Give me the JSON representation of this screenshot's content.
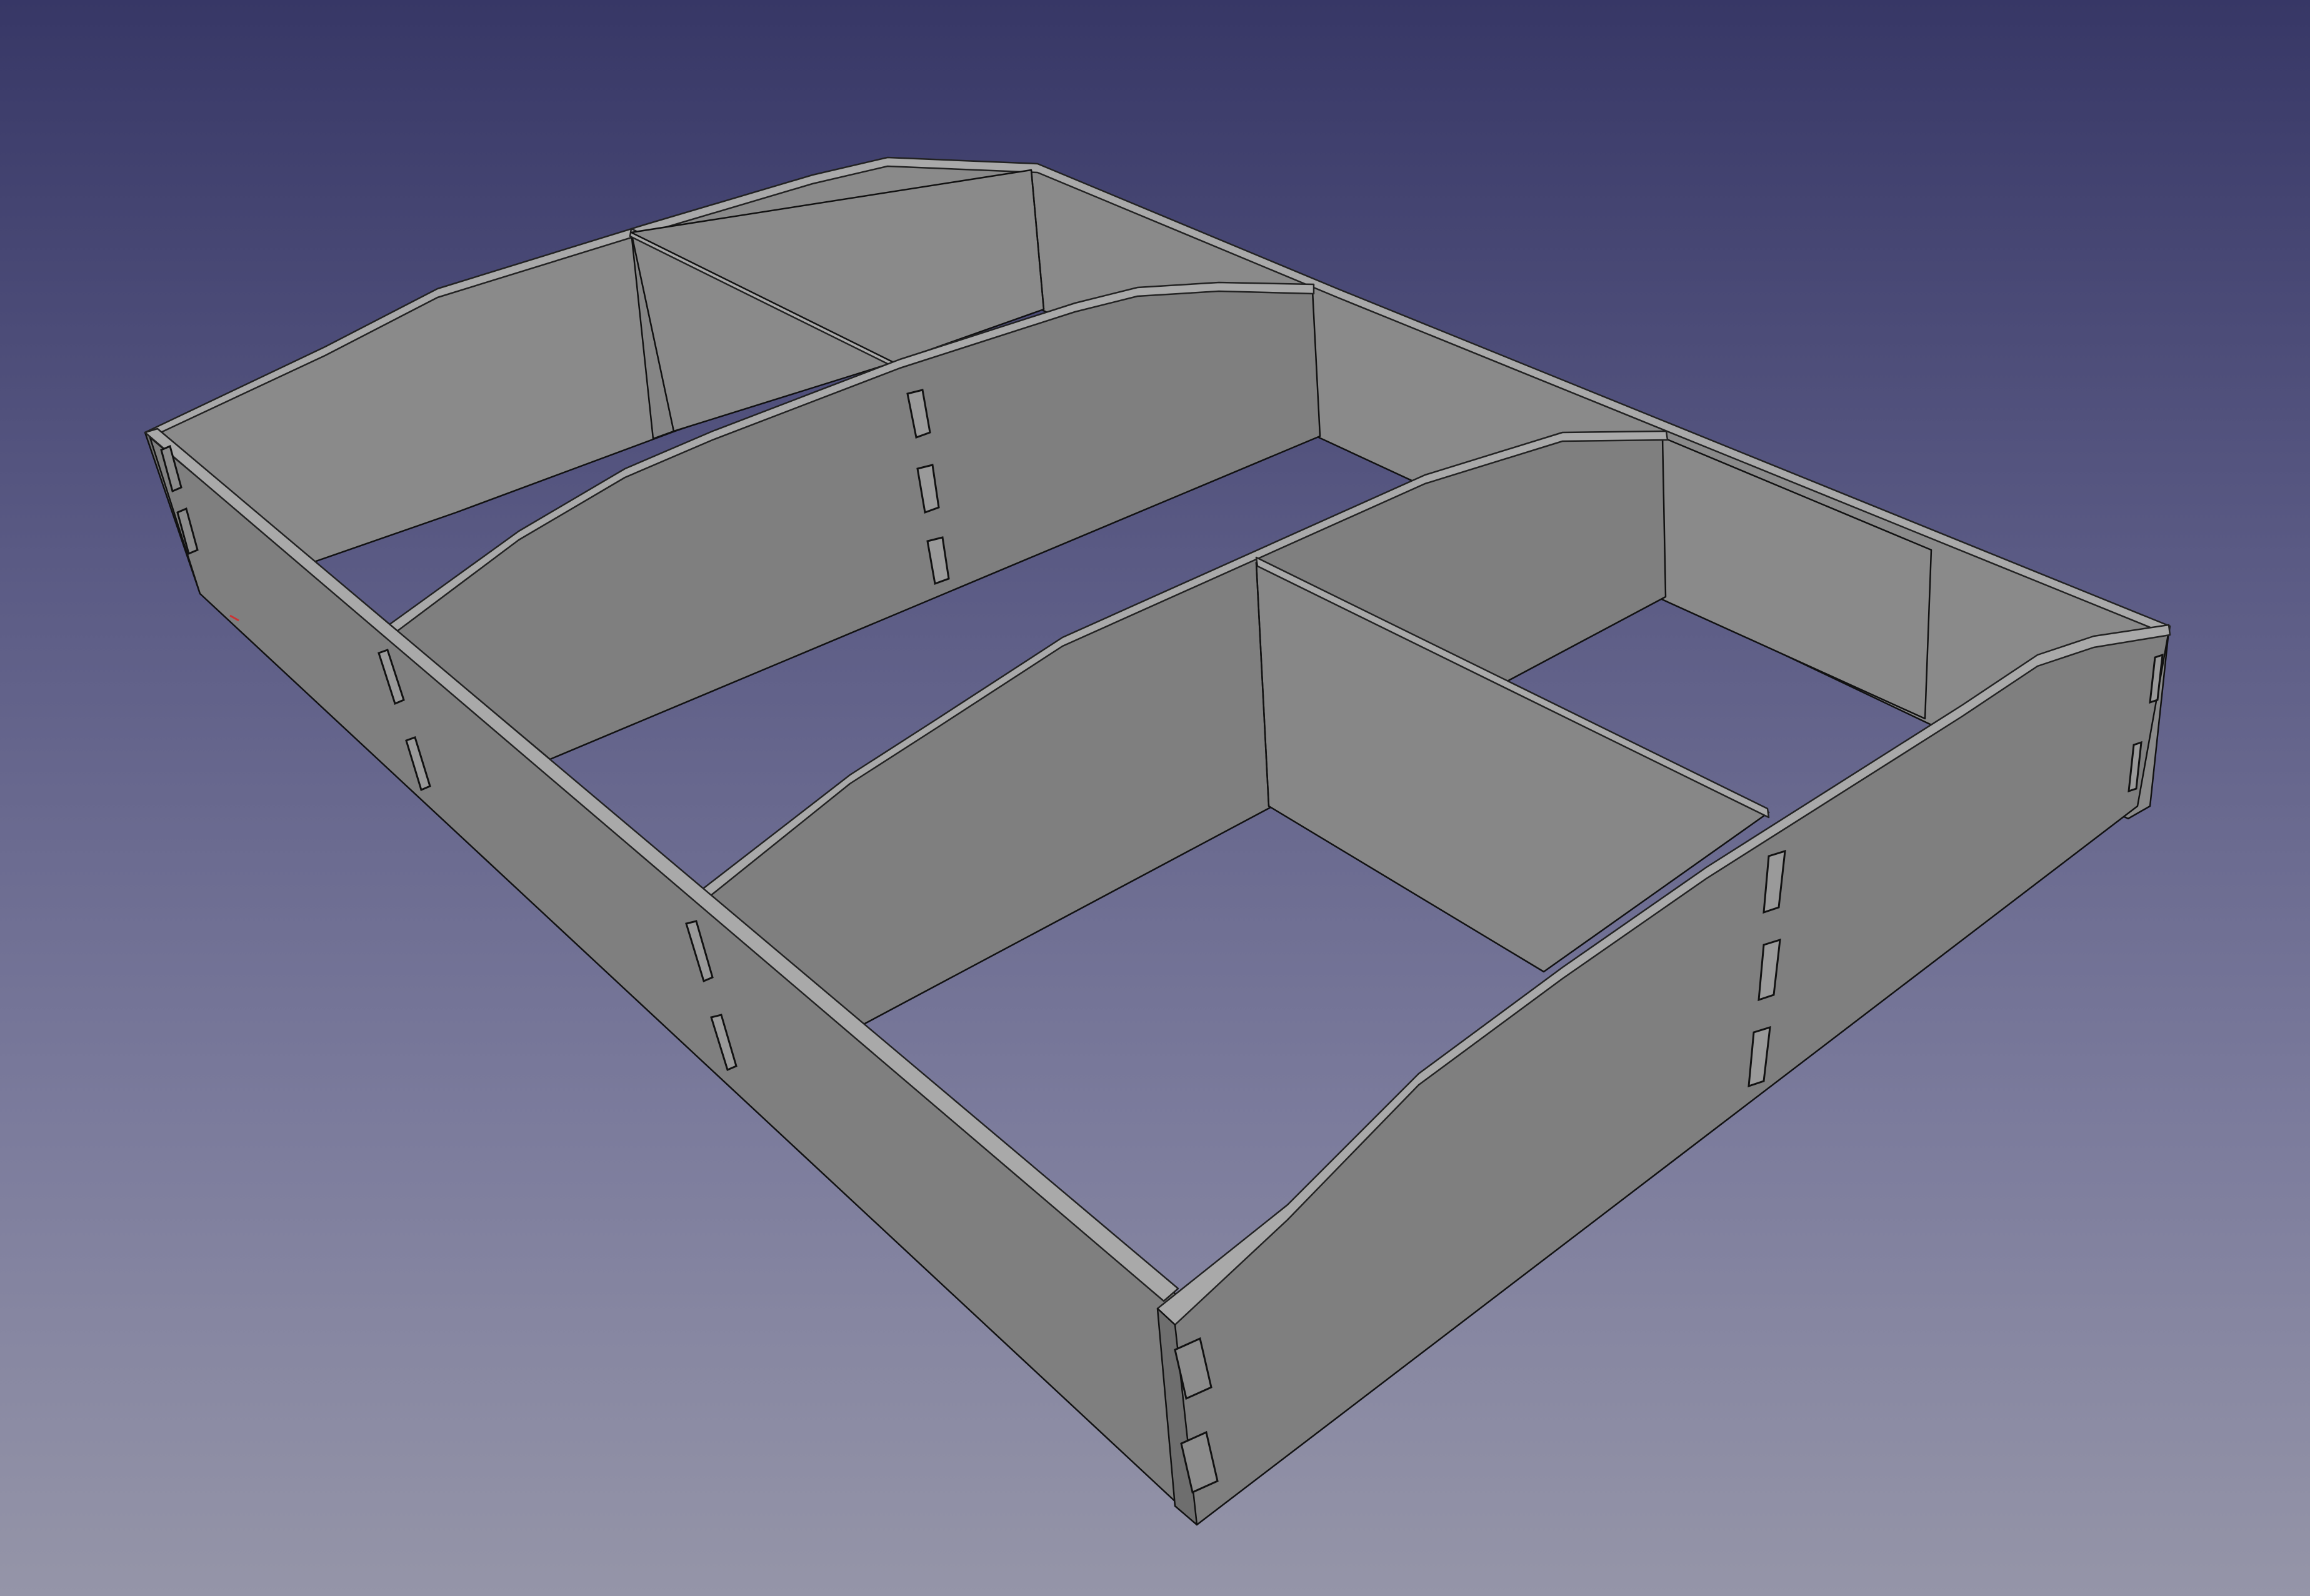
{
  "viewport": {
    "background_top": "#373766",
    "background_bottom": "#9595a8"
  },
  "model": {
    "type": "3d-part",
    "description_icon": "tray-with-dividers-icon",
    "material_color": "#7f7f7f",
    "edge_color": "#111111"
  }
}
